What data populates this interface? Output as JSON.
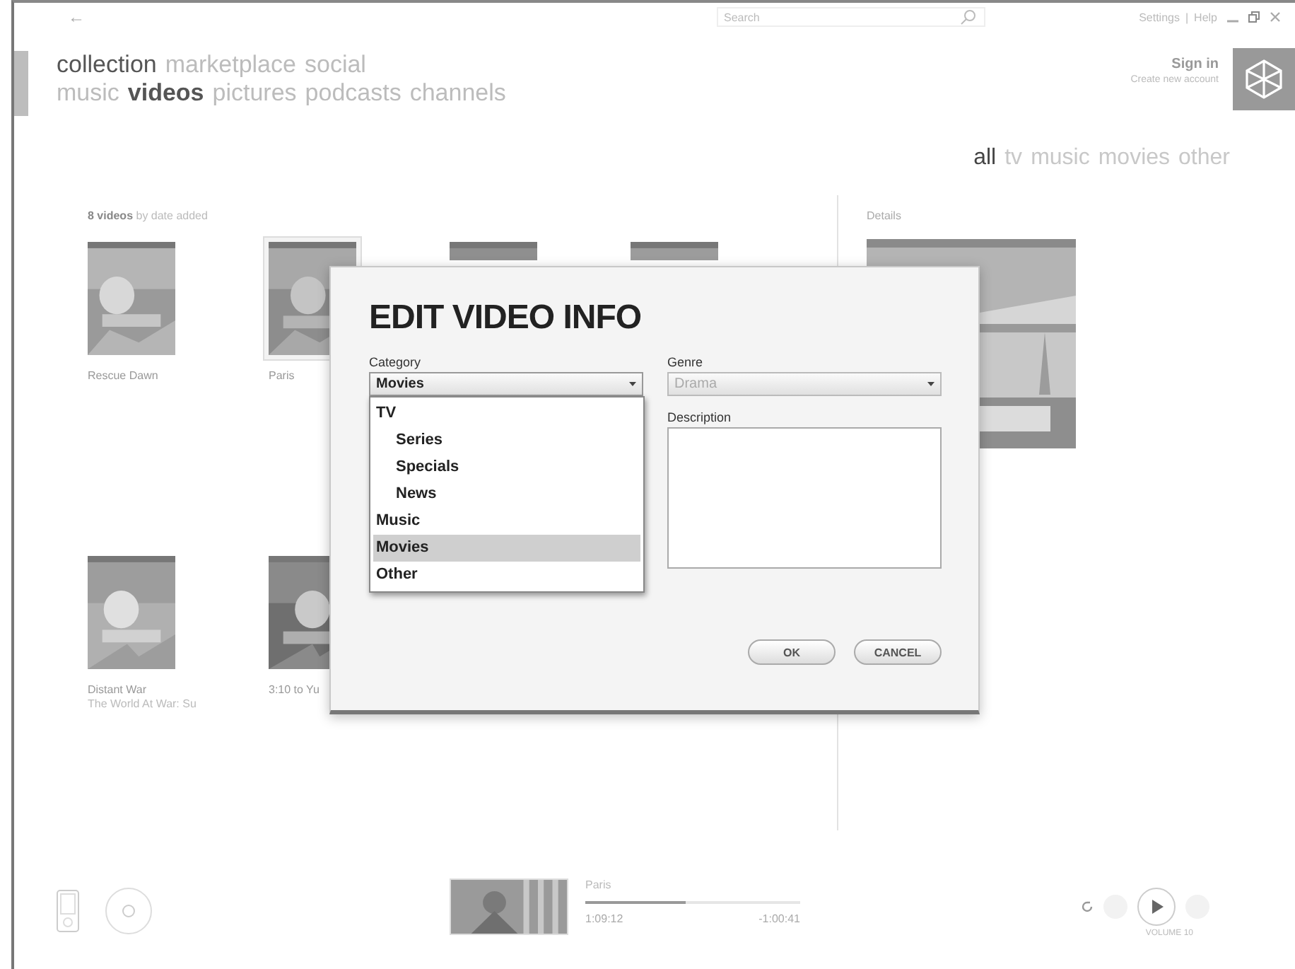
{
  "top_bar": {
    "back": "←",
    "search": {
      "placeholder": "Search"
    },
    "links": [
      "Settings",
      "Help"
    ],
    "separator": "|"
  },
  "pivot": {
    "primary": [
      {
        "label": "collection",
        "selected": true
      },
      {
        "label": "marketplace",
        "selected": false
      },
      {
        "label": "social",
        "selected": false
      }
    ],
    "secondary": [
      {
        "label": "music",
        "selected": false
      },
      {
        "label": "videos",
        "selected": true
      },
      {
        "label": "pictures",
        "selected": false
      },
      {
        "label": "podcasts",
        "selected": false
      },
      {
        "label": "channels",
        "selected": false
      }
    ]
  },
  "account": {
    "sign_in": "Sign in",
    "create": "Create new account"
  },
  "filters": [
    {
      "label": "all",
      "selected": true
    },
    {
      "label": "tv",
      "selected": false
    },
    {
      "label": "music",
      "selected": false
    },
    {
      "label": "movies",
      "selected": false
    },
    {
      "label": "other",
      "selected": false
    }
  ],
  "library": {
    "count": "8 videos",
    "sort": "by date added",
    "videos": [
      {
        "title": "Rescue Dawn",
        "selected": false
      },
      {
        "title": "Paris",
        "selected": true
      },
      {
        "selected": false
      },
      {
        "selected": false
      },
      {
        "title": "Distant War",
        "subtitle": "The World At War: Su",
        "selected": false
      },
      {
        "title": "3:10 to Yu",
        "selected": false
      }
    ]
  },
  "details": {
    "heading": "Details"
  },
  "dialog": {
    "title": "EDIT VIDEO INFO",
    "category": {
      "label": "Category",
      "value": "Movies",
      "expanded": true,
      "options": [
        {
          "label": "TV",
          "selected": false,
          "children": [
            {
              "label": "Series",
              "selected": false
            },
            {
              "label": "Specials",
              "selected": false
            },
            {
              "label": "News",
              "selected": false
            }
          ]
        },
        {
          "label": "Music",
          "selected": false
        },
        {
          "label": "Movies",
          "selected": true
        },
        {
          "label": "Other",
          "selected": false
        }
      ]
    },
    "genre": {
      "label": "Genre",
      "value": "Drama",
      "disabled": true
    },
    "description": {
      "label": "Description"
    },
    "buttons": [
      "OK",
      "CANCEL"
    ]
  },
  "now_playing": {
    "title": "Paris",
    "level": 0.47,
    "elapsed": "1:09:12",
    "remaining": "-1:00:41",
    "volume": "VOLUME 10"
  }
}
